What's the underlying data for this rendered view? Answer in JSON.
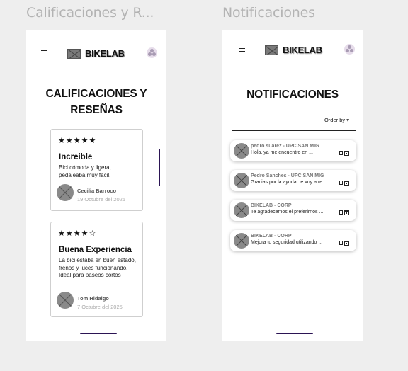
{
  "frames": {
    "left_label": "Calificaciones y R...",
    "right_label": "Notificaciones"
  },
  "brand": {
    "name": "BIKELAB"
  },
  "reviews_screen": {
    "title_line1": "CALIFICACIONES Y",
    "title_line2": "RESEÑAS",
    "reviews": [
      {
        "stars": "★★★★★",
        "rating": 5,
        "title": "Increible",
        "body": "Bici cómoda y ligera, pedaleaba muy fácil.",
        "author": "Cecilia Barroco",
        "date": "19 Octubre del 2025"
      },
      {
        "stars": "★★★★☆",
        "rating": 4,
        "title": "Buena Experiencia",
        "body": "La bici estaba en buen estado, frenos y luces funcionando. Ideal para paseos cortos",
        "author": "Tom Hidalgo",
        "date": "7 Octubre del 2025"
      }
    ]
  },
  "notifications_screen": {
    "title": "NOTIFICACIONES",
    "order_by": "Order by ▾",
    "items": [
      {
        "sender": "pedro suarez - UPC SAN MIG",
        "message": "Hola, ya me encuentro en ..."
      },
      {
        "sender": "Pedro Sanches - UPC SAN MIG",
        "message": "Gracias por la ayuda, te voy a re..."
      },
      {
        "sender": "BIKELAB - CORP",
        "message": "Te agradecemos el preferirnos ..."
      },
      {
        "sender": "BIKELAB - CORP",
        "message": "Mejora tu seguridad utilizando ..."
      }
    ]
  },
  "icons": {
    "menu": "hamburger-menu-icon",
    "logo": "image-placeholder-icon",
    "profile": "profile-icon",
    "delete": "trash-icon",
    "schedule": "calendar-icon"
  },
  "colors": {
    "accent": "#2b1454",
    "background": "#eeeeee",
    "frame": "#ffffff"
  }
}
